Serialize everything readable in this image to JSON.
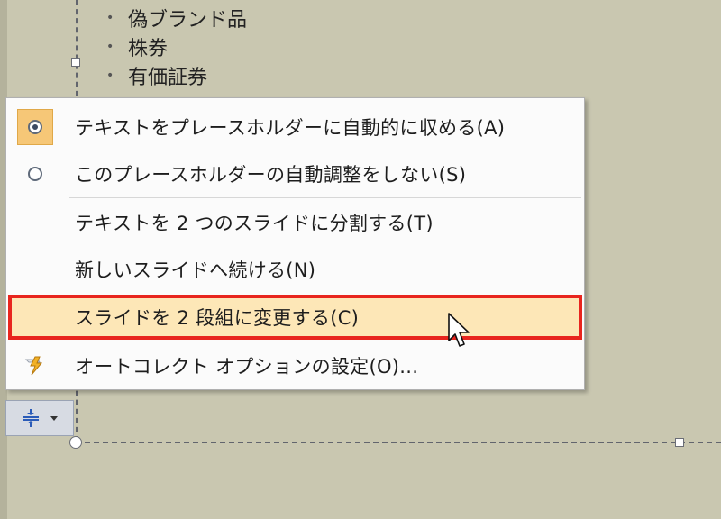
{
  "bullets": [
    "偽ブランド品",
    "株券",
    "有価証券"
  ],
  "menu": {
    "items": [
      {
        "label": "テキストをプレースホルダーに自動的に収める(A)",
        "selected": true,
        "icon": "radio-selected"
      },
      {
        "label": "このプレースホルダーの自動調整をしない(S)",
        "selected": false,
        "icon": "radio-unselected"
      },
      {
        "label": "テキストを 2 つのスライドに分割する(T)"
      },
      {
        "label": "新しいスライドへ続ける(N)"
      },
      {
        "label": "スライドを 2 段組に変更する(C)",
        "highlighted": true
      },
      {
        "label": "オートコレクト オプションの設定(O)...",
        "icon": "lightning-icon"
      }
    ]
  },
  "colors": {
    "highlight_border": "#e8251e",
    "highlight_fill": "#fde7b7",
    "slide_bg": "#c9c7b0",
    "checked_bg": "#f6c777"
  }
}
